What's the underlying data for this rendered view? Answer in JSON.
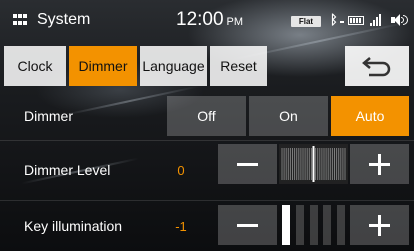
{
  "status_bar": {
    "title": "System",
    "time": "12:00",
    "ampm": "PM",
    "eq_badge": "Flat",
    "icons": [
      "menu-grid-icon",
      "bluetooth-icon",
      "battery-icon",
      "signal-icon",
      "volume-icon"
    ]
  },
  "tabs": [
    {
      "label": "Clock",
      "active": false
    },
    {
      "label": "Dimmer",
      "active": true
    },
    {
      "label": "Language",
      "active": false
    },
    {
      "label": "Reset",
      "active": false
    }
  ],
  "back_button": {
    "icon": "back-arrow-icon"
  },
  "dimmer": {
    "label": "Dimmer",
    "options": [
      "Off",
      "On",
      "Auto"
    ],
    "selected": "Auto"
  },
  "dimmer_level": {
    "label": "Dimmer Level",
    "value": "0",
    "min": -15,
    "max": 15,
    "current": 0
  },
  "key_illumination": {
    "label": "Key illumination",
    "value": "-1",
    "steps_total": 5,
    "current_step": 1
  },
  "colors": {
    "accent": "#f39200",
    "tab_bg": "#e6e6e6",
    "button_bg": "#555555",
    "text": "#ffffff"
  }
}
